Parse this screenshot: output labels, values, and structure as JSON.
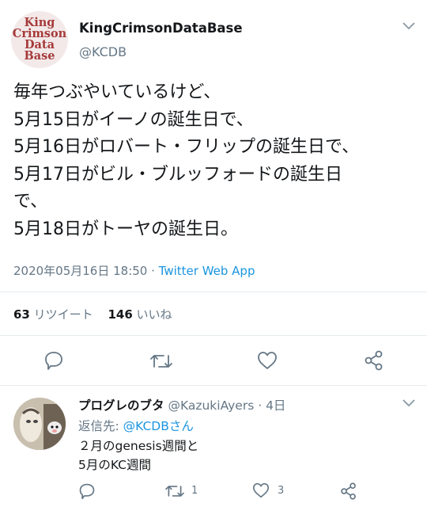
{
  "tweet": {
    "logo_lines": [
      "King",
      "Crimson",
      "Data",
      "Base"
    ],
    "display_name": "KingCrimsonDataBase",
    "handle": "@KCDB",
    "lines": [
      "毎年つぶやいているけど、",
      "5月15日がイーノの誕生日で、",
      "5月16日がロバート・フリップの誕生日で、",
      "5月17日がビル・ブルッフォードの誕生日",
      "で、",
      "5月18日がトーヤの誕生日。"
    ],
    "timestamp": "2020年05月16日 18:50",
    "separator": " · ",
    "source": "Twitter Web App",
    "retweets_count": "63",
    "retweets_label": "リツイート",
    "likes_count": "146",
    "likes_label": "いいね"
  },
  "actions": {
    "reply_icon": "comment-icon",
    "retweet_icon": "retweet-icon",
    "like_icon": "heart-icon",
    "share_icon": "share-icon"
  },
  "reply": {
    "display_name": "プログレのブタ",
    "handle_time": " @KazukiAyers · 4日",
    "reply_to_label": "返信先: ",
    "reply_to_link": "@KCDBさん",
    "lines": [
      "２月のgenesis週間と",
      "5月のKC週間"
    ],
    "retweets": "1",
    "likes": "3"
  },
  "colors": {
    "accent": "#1b95e0",
    "muted": "#657786",
    "logo": "#a63a3a"
  }
}
